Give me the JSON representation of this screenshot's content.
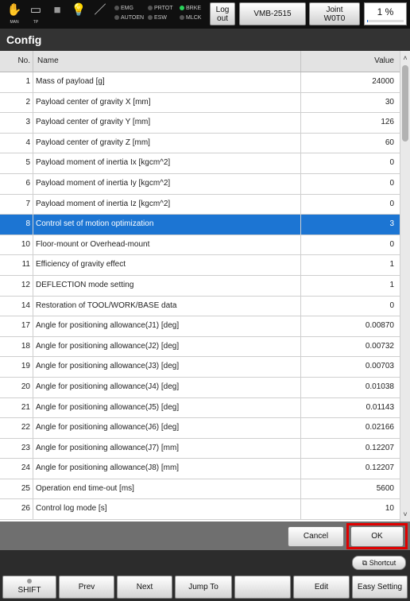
{
  "topbar": {
    "icons": [
      {
        "name": "hand-icon",
        "caption": "MAN",
        "glyph": "✋",
        "color": "#f1c232"
      },
      {
        "name": "teach-pendant-icon",
        "caption": "TP",
        "glyph": "▭",
        "color": "#d8d8d8"
      },
      {
        "name": "stop-square-icon",
        "caption": "",
        "glyph": "■",
        "color": "#9a9a9a"
      },
      {
        "name": "lightbulb-icon",
        "caption": "",
        "glyph": "💡",
        "color": "#f7e26b"
      },
      {
        "name": "wrench-icon",
        "caption": "",
        "glyph": "／",
        "color": "#dddddd"
      }
    ],
    "lamps_left": [
      {
        "label": "EMG",
        "on": false
      },
      {
        "label": "AUTOEN",
        "on": false
      }
    ],
    "lamps_mid": [
      {
        "label": "PRTOT",
        "on": false
      },
      {
        "label": "ESW",
        "on": false
      }
    ],
    "lamps_right": [
      {
        "label": "BRKE",
        "on": true
      },
      {
        "label": "MLCK",
        "on": false
      }
    ],
    "logout_label": [
      "Log",
      "out"
    ],
    "robot_label": "VMB-2515",
    "mode_label": [
      "Joint",
      "W0T0"
    ],
    "speed_label": "1 %",
    "speed_value": 0.01
  },
  "title": "Config",
  "table": {
    "headers": {
      "no": "No.",
      "name": "Name",
      "value": "Value"
    },
    "rows": [
      {
        "no": "1",
        "name": "Mass of payload [g]",
        "value": "24000"
      },
      {
        "no": "2",
        "name": "Payload center of gravity X [mm]",
        "value": "30"
      },
      {
        "no": "3",
        "name": "Payload center of gravity Y [mm]",
        "value": "126"
      },
      {
        "no": "4",
        "name": "Payload center of gravity Z [mm]",
        "value": "60"
      },
      {
        "no": "5",
        "name": "Payload moment of inertia Ix [kgcm^2]",
        "value": "0"
      },
      {
        "no": "6",
        "name": "Payload moment of inertia Iy [kgcm^2]",
        "value": "0"
      },
      {
        "no": "7",
        "name": "Payload moment of inertia Iz [kgcm^2]",
        "value": "0"
      },
      {
        "no": "8",
        "name": "Control set of motion optimization",
        "value": "3",
        "selected": true
      },
      {
        "no": "10",
        "name": "Floor-mount or Overhead-mount",
        "value": "0"
      },
      {
        "no": "11",
        "name": "Efficiency of gravity effect",
        "value": "1"
      },
      {
        "no": "12",
        "name": "DEFLECTION mode setting",
        "value": "1"
      },
      {
        "no": "14",
        "name": "Restoration of TOOL/WORK/BASE data",
        "value": "0"
      },
      {
        "no": "17",
        "name": "Angle for positioning allowance(J1) [deg]",
        "value": "0.00870"
      },
      {
        "no": "18",
        "name": "Angle for positioning allowance(J2) [deg]",
        "value": "0.00732"
      },
      {
        "no": "19",
        "name": "Angle for positioning allowance(J3) [deg]",
        "value": "0.00703"
      },
      {
        "no": "20",
        "name": "Angle for positioning allowance(J4) [deg]",
        "value": "0.01038"
      },
      {
        "no": "21",
        "name": "Angle for positioning allowance(J5) [deg]",
        "value": "0.01143"
      },
      {
        "no": "22",
        "name": "Angle for positioning allowance(J6) [deg]",
        "value": "0.02166"
      },
      {
        "no": "23",
        "name": "Angle for positioning allowance(J7) [mm]",
        "value": "0.12207"
      },
      {
        "no": "24",
        "name": "Angle for positioning allowance(J8) [mm]",
        "value": "0.12207"
      },
      {
        "no": "25",
        "name": "Operation end time-out  [ms]",
        "value": "5600"
      },
      {
        "no": "26",
        "name": "Control log mode [s]",
        "value": "10"
      }
    ]
  },
  "actions": {
    "cancel": "Cancel",
    "ok": "OK"
  },
  "shortcut_label": "Shortcut",
  "function_keys": {
    "shift": "SHIFT",
    "prev": "Prev",
    "next": "Next",
    "jump_to": "Jump To",
    "blank": "",
    "edit": "Edit",
    "easy_setting": "Easy Setting"
  },
  "colors": {
    "selected_row": "#1c75d3",
    "ok_highlight": "#e00000",
    "lamp_on": "#29d35a"
  }
}
